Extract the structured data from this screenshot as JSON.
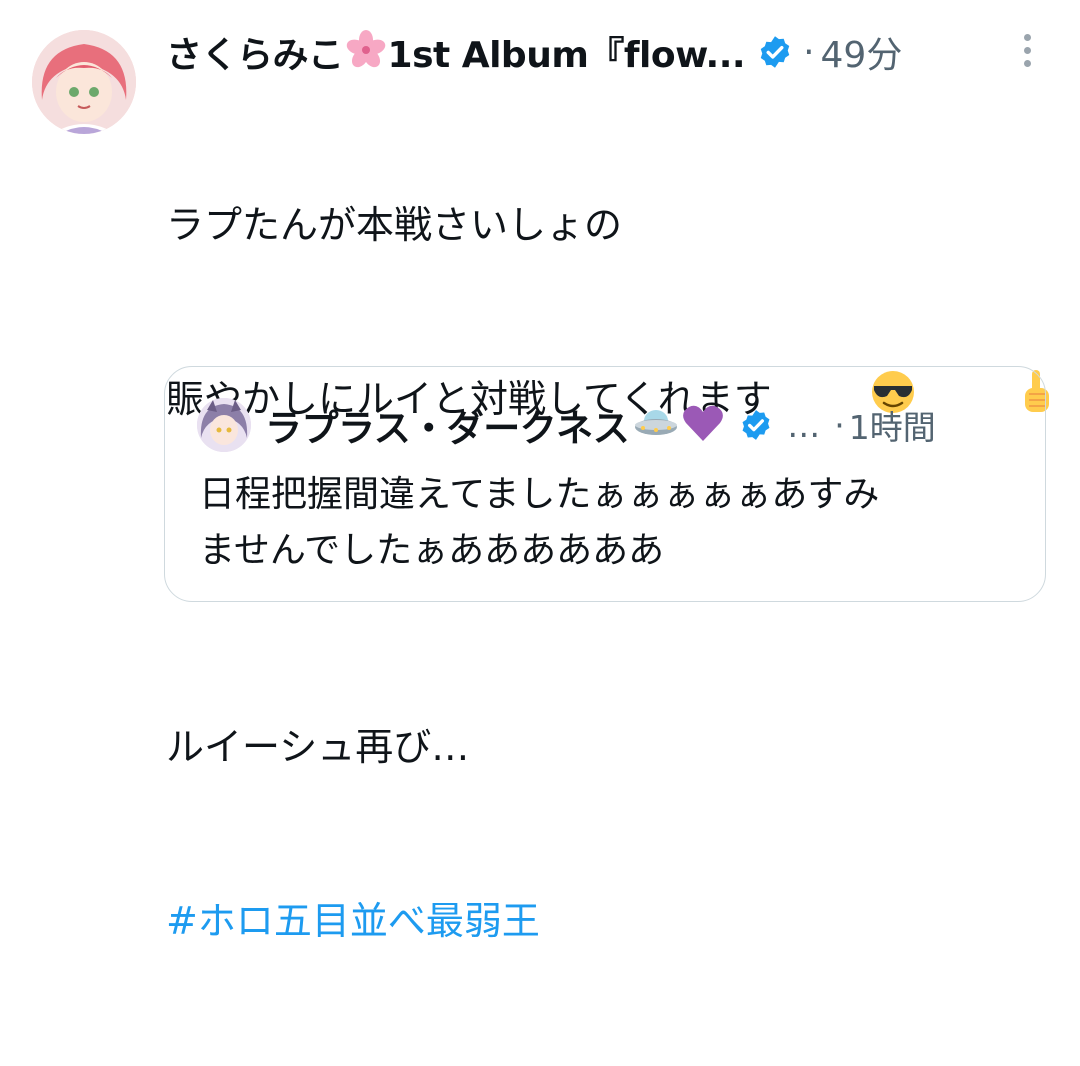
{
  "tweet": {
    "author_name": "さくらみこ",
    "author_suffix": "1st Album『flow...",
    "separator": "·",
    "time": "49分",
    "lines": [
      "ラプたんが本戦さいしょの",
      "賑やかしにルイと対戦してくれます",
      "",
      "ルイーシュ再び…"
    ],
    "hashtag": "#ホロ五目並べ最弱王"
  },
  "quote": {
    "author_name": "ラプラス・ダークネス",
    "ellipsis": "…",
    "separator": "·",
    "time": "1時間",
    "lines": [
      "日程把握間違えてましたぁぁぁぁぁあすみ",
      "ませんでしたぁああああああ"
    ]
  },
  "colors": {
    "link": "#1d9bf0",
    "verified": "#1d9bf0",
    "meta": "#536471",
    "border": "#cfd9de"
  },
  "icons": [
    "cherry-blossom-emoji",
    "verified-badge-icon",
    "more-options-icon",
    "sunglasses-emoji",
    "pointing-up-emoji",
    "ufo-emoji",
    "purple-heart-emoji"
  ]
}
